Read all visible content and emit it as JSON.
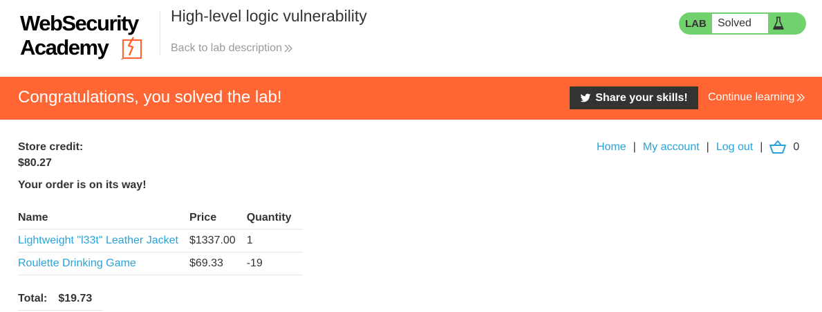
{
  "header": {
    "logo_line1": "WebSecurity",
    "logo_line2": "Academy",
    "title": "High-level logic vulnerability",
    "back_link": "Back to lab description",
    "status": {
      "tag": "LAB",
      "value": "Solved",
      "icon": "flask-icon",
      "color": "#70d16d"
    }
  },
  "banner": {
    "message": "Congratulations, you solved the lab!",
    "share_label": "Share your skills!",
    "share_icon": "twitter-icon",
    "continue_label": "Continue learning",
    "color": "#ff6633"
  },
  "account": {
    "credit_label": "Store credit:",
    "credit_value": "$80.27",
    "order_message": "Your order is on its way!"
  },
  "nav": {
    "home": "Home",
    "my_account": "My account",
    "log_out": "Log out",
    "separator": "|",
    "cart_icon": "cart-icon",
    "cart_count": "0",
    "link_color": "#29a3d9"
  },
  "order": {
    "columns": [
      "Name",
      "Price",
      "Quantity"
    ],
    "rows": [
      {
        "name": "Lightweight \"l33t\" Leather Jacket",
        "price": "$1337.00",
        "quantity": "1"
      },
      {
        "name": "Roulette Drinking Game",
        "price": "$69.33",
        "quantity": "-19"
      }
    ],
    "total_label": "Total:",
    "total_value": "$19.73"
  }
}
